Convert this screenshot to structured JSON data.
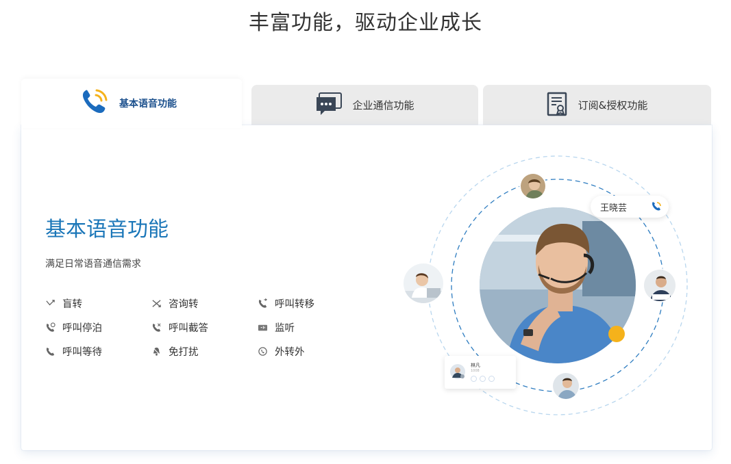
{
  "header": {
    "title": "丰富功能，驱动企业成长"
  },
  "tabs": [
    {
      "label": "基本语音功能",
      "icon": "phone-icon",
      "active": true
    },
    {
      "label": "企业通信功能",
      "icon": "chat-bubble-icon",
      "active": false
    },
    {
      "label": "订阅&授权功能",
      "icon": "certificate-icon",
      "active": false
    }
  ],
  "section": {
    "title": "基本语音功能",
    "subtitle": "满足日常语音通信需求"
  },
  "features": [
    {
      "label": "盲转",
      "icon": "blind-transfer-icon"
    },
    {
      "label": "咨询转",
      "icon": "consult-transfer-icon"
    },
    {
      "label": "呼叫转移",
      "icon": "call-forward-icon"
    },
    {
      "label": "呼叫停泊",
      "icon": "call-park-icon"
    },
    {
      "label": "呼叫截答",
      "icon": "call-pickup-icon"
    },
    {
      "label": "监听",
      "icon": "monitor-icon"
    },
    {
      "label": "呼叫等待",
      "icon": "call-wait-icon"
    },
    {
      "label": "免打扰",
      "icon": "do-not-disturb-icon"
    },
    {
      "label": "外转外",
      "icon": "external-transfer-icon"
    }
  ],
  "illustration": {
    "name_chip": "王晓芸",
    "contact_card": {
      "name": "林凡",
      "number": "1008"
    }
  },
  "colors": {
    "accent": "#1a76b8",
    "tab_inactive": "#ebebeb",
    "ring": "#9ec6e6",
    "dot": "#f5b21b"
  }
}
